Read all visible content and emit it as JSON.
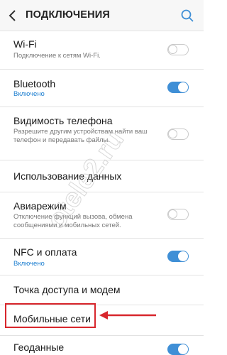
{
  "header": {
    "title": "ПОДКЛЮЧЕНИЯ",
    "back_icon": "chevron-left-icon",
    "search_icon": "search-icon"
  },
  "accent_color": "#3f8fd6",
  "highlight_color": "#d8262c",
  "items": [
    {
      "title": "Wi-Fi",
      "subtitle": "Подключение к сетям Wi-Fi.",
      "toggle": false
    },
    {
      "title": "Bluetooth",
      "subtitle": "Включено",
      "toggle": true
    },
    {
      "title": "Видимость телефона",
      "subtitle": "Разрешите другим устройствам найти ваш телефон и передавать файлы.",
      "toggle": false
    },
    {
      "title": "Использование данных"
    },
    {
      "title": "Авиарежим",
      "subtitle": "Отключение функций вызова, обмена сообщениями и мобильных сетей.",
      "toggle": false
    },
    {
      "title": "NFC и оплата",
      "subtitle": "Включено",
      "toggle": true
    },
    {
      "title": "Точка доступа и модем"
    },
    {
      "title": "Мобильные сети"
    },
    {
      "title": "Геоданные",
      "toggle": true
    }
  ],
  "watermark": "otele2.ru"
}
